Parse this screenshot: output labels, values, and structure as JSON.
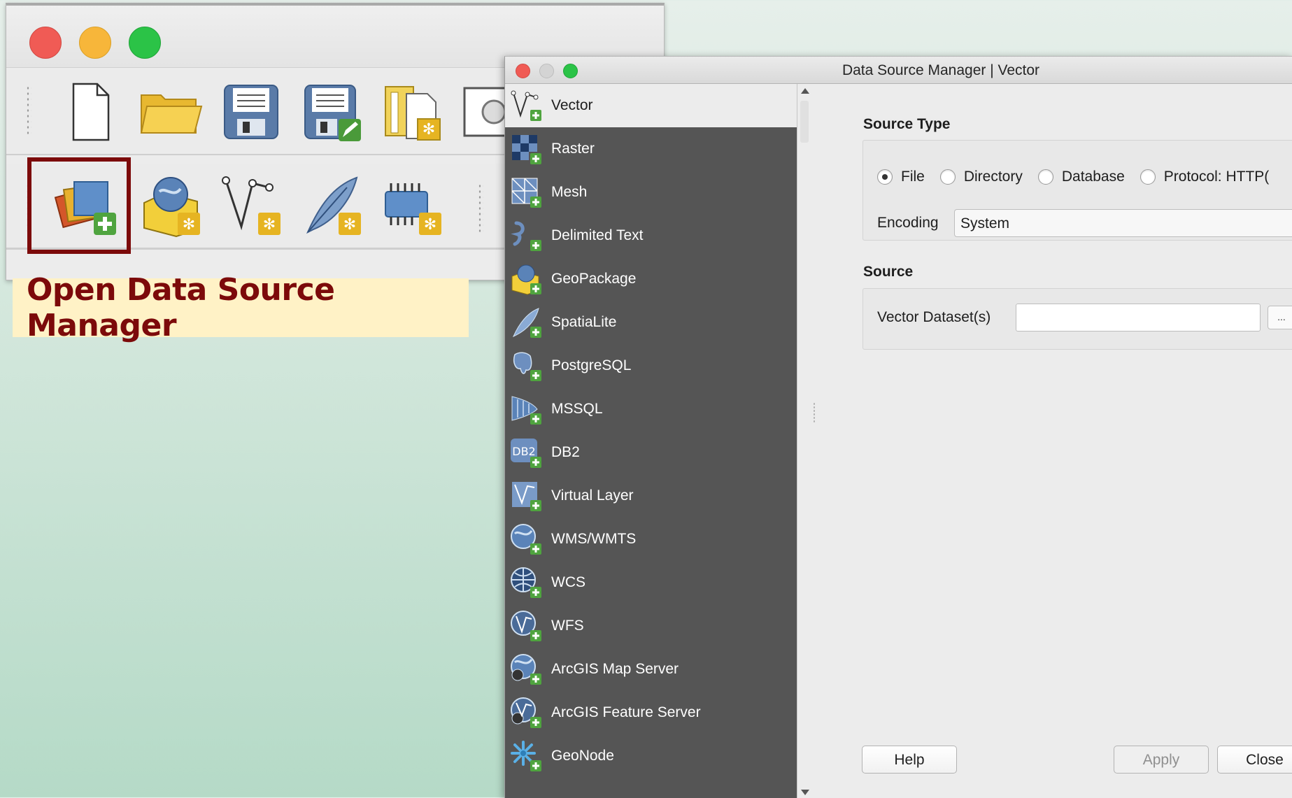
{
  "main_window": {
    "toolbar_file": {
      "buttons": [
        {
          "name": "new-project-icon"
        },
        {
          "name": "open-project-icon"
        },
        {
          "name": "save-project-icon"
        },
        {
          "name": "save-as-icon"
        },
        {
          "name": "new-print-layout-icon"
        },
        {
          "name": "layout-manager-icon"
        }
      ]
    },
    "toolbar_manage": {
      "buttons": [
        {
          "name": "data-source-manager-icon"
        },
        {
          "name": "new-geopackage-layer-icon"
        },
        {
          "name": "new-shapefile-layer-icon"
        },
        {
          "name": "new-spatialite-layer-icon"
        },
        {
          "name": "new-temporary-layer-icon"
        }
      ]
    },
    "callout_text": "Open Data Source Manager",
    "highlight_color": "#7c0a0a"
  },
  "dialog": {
    "title": "Data Source Manager | Vector",
    "sidebar": {
      "items": [
        {
          "label": "Vector",
          "icon": "vector-icon",
          "selected": true
        },
        {
          "label": "Raster",
          "icon": "raster-icon"
        },
        {
          "label": "Mesh",
          "icon": "mesh-icon"
        },
        {
          "label": "Delimited Text",
          "icon": "delimited-text-icon"
        },
        {
          "label": "GeoPackage",
          "icon": "geopackage-icon"
        },
        {
          "label": "SpatiaLite",
          "icon": "spatialite-icon"
        },
        {
          "label": "PostgreSQL",
          "icon": "postgresql-icon"
        },
        {
          "label": "MSSQL",
          "icon": "mssql-icon"
        },
        {
          "label": "DB2",
          "icon": "db2-icon"
        },
        {
          "label": "Virtual Layer",
          "icon": "virtual-layer-icon"
        },
        {
          "label": "WMS/WMTS",
          "icon": "wms-icon"
        },
        {
          "label": "WCS",
          "icon": "wcs-icon"
        },
        {
          "label": "WFS",
          "icon": "wfs-icon"
        },
        {
          "label": "ArcGIS Map Server",
          "icon": "arcgis-map-server-icon"
        },
        {
          "label": "ArcGIS Feature Server",
          "icon": "arcgis-feature-server-icon"
        },
        {
          "label": "GeoNode",
          "icon": "geonode-icon"
        }
      ]
    },
    "source_type": {
      "title": "Source Type",
      "options": [
        "File",
        "Directory",
        "Database",
        "Protocol: HTTP("
      ],
      "selected": "File",
      "encoding_label": "Encoding",
      "encoding_value": "System"
    },
    "source": {
      "title": "Source",
      "dataset_label": "Vector Dataset(s)",
      "dataset_value": "",
      "browse_label": "..."
    },
    "buttons": {
      "help": "Help",
      "apply": "Apply",
      "close": "Close"
    }
  }
}
